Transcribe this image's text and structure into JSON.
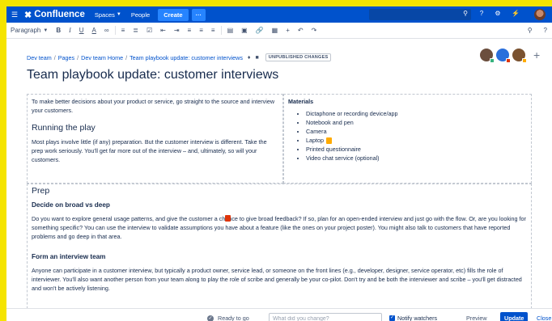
{
  "colors": {
    "accent": "#0052cc",
    "banner": "#f5e400"
  },
  "topnav": {
    "brand": "Confluence",
    "spaces": "Spaces",
    "people": "People",
    "create": "Create",
    "more": "···"
  },
  "toolbar": {
    "paragraph": "Paragraph",
    "bold": "B",
    "italic": "I",
    "underline": "U",
    "color": "A"
  },
  "breadcrumb": {
    "items": [
      "Dev team",
      "Pages",
      "Dev team Home",
      "Team playbook update: customer interviews"
    ],
    "status_badge": "UNPUBLISHED CHANGES"
  },
  "page": {
    "title": "Team playbook update: customer interviews"
  },
  "left_cell": {
    "intro": "To make better decisions about your product or service, go straight to the source and interview your customers.",
    "heading": "Running the play",
    "body": "Most plays involve little (if any) preparation. But the customer interview is different. Take the prep work seriously. You'll get far more out of the interview – and, ultimately, so will your customers."
  },
  "materials": {
    "heading": "Materials",
    "items": [
      "Dictaphone or recording device/app",
      "Notebook and pen",
      "Camera",
      "Laptop",
      "Printed questionnaire",
      "Video chat service (optional)"
    ]
  },
  "prep": {
    "heading": "Prep",
    "sub1": "Decide on broad vs deep",
    "para1": "Do you want to explore general usage patterns, and give the customer a chance to give broad feedback? If so, plan for an open-ended interview and just go with the flow. Or, are you looking for something specific? You can use the interview to validate assumptions you have about a feature (like the ones on your project poster). You might also talk to customers that have reported problems and go deep in that area.",
    "sub2": "Form an interview team",
    "para2": "Anyone can participate in a customer interview, but typically a product owner, service lead, or someone on the front lines (e.g., developer, designer, service operator, etc) fills the role of interviewer. You'll also want another person from your team along to play the role of scribe and generally be your co-pilot. Don't try and be both the interviewer and scribe – you'll get distracted and won't be actively listening."
  },
  "bottombar": {
    "ready": "Ready to go",
    "change_placeholder": "What did you change?",
    "notify": "Notify watchers",
    "preview": "Preview",
    "update": "Update",
    "close": "Close"
  }
}
